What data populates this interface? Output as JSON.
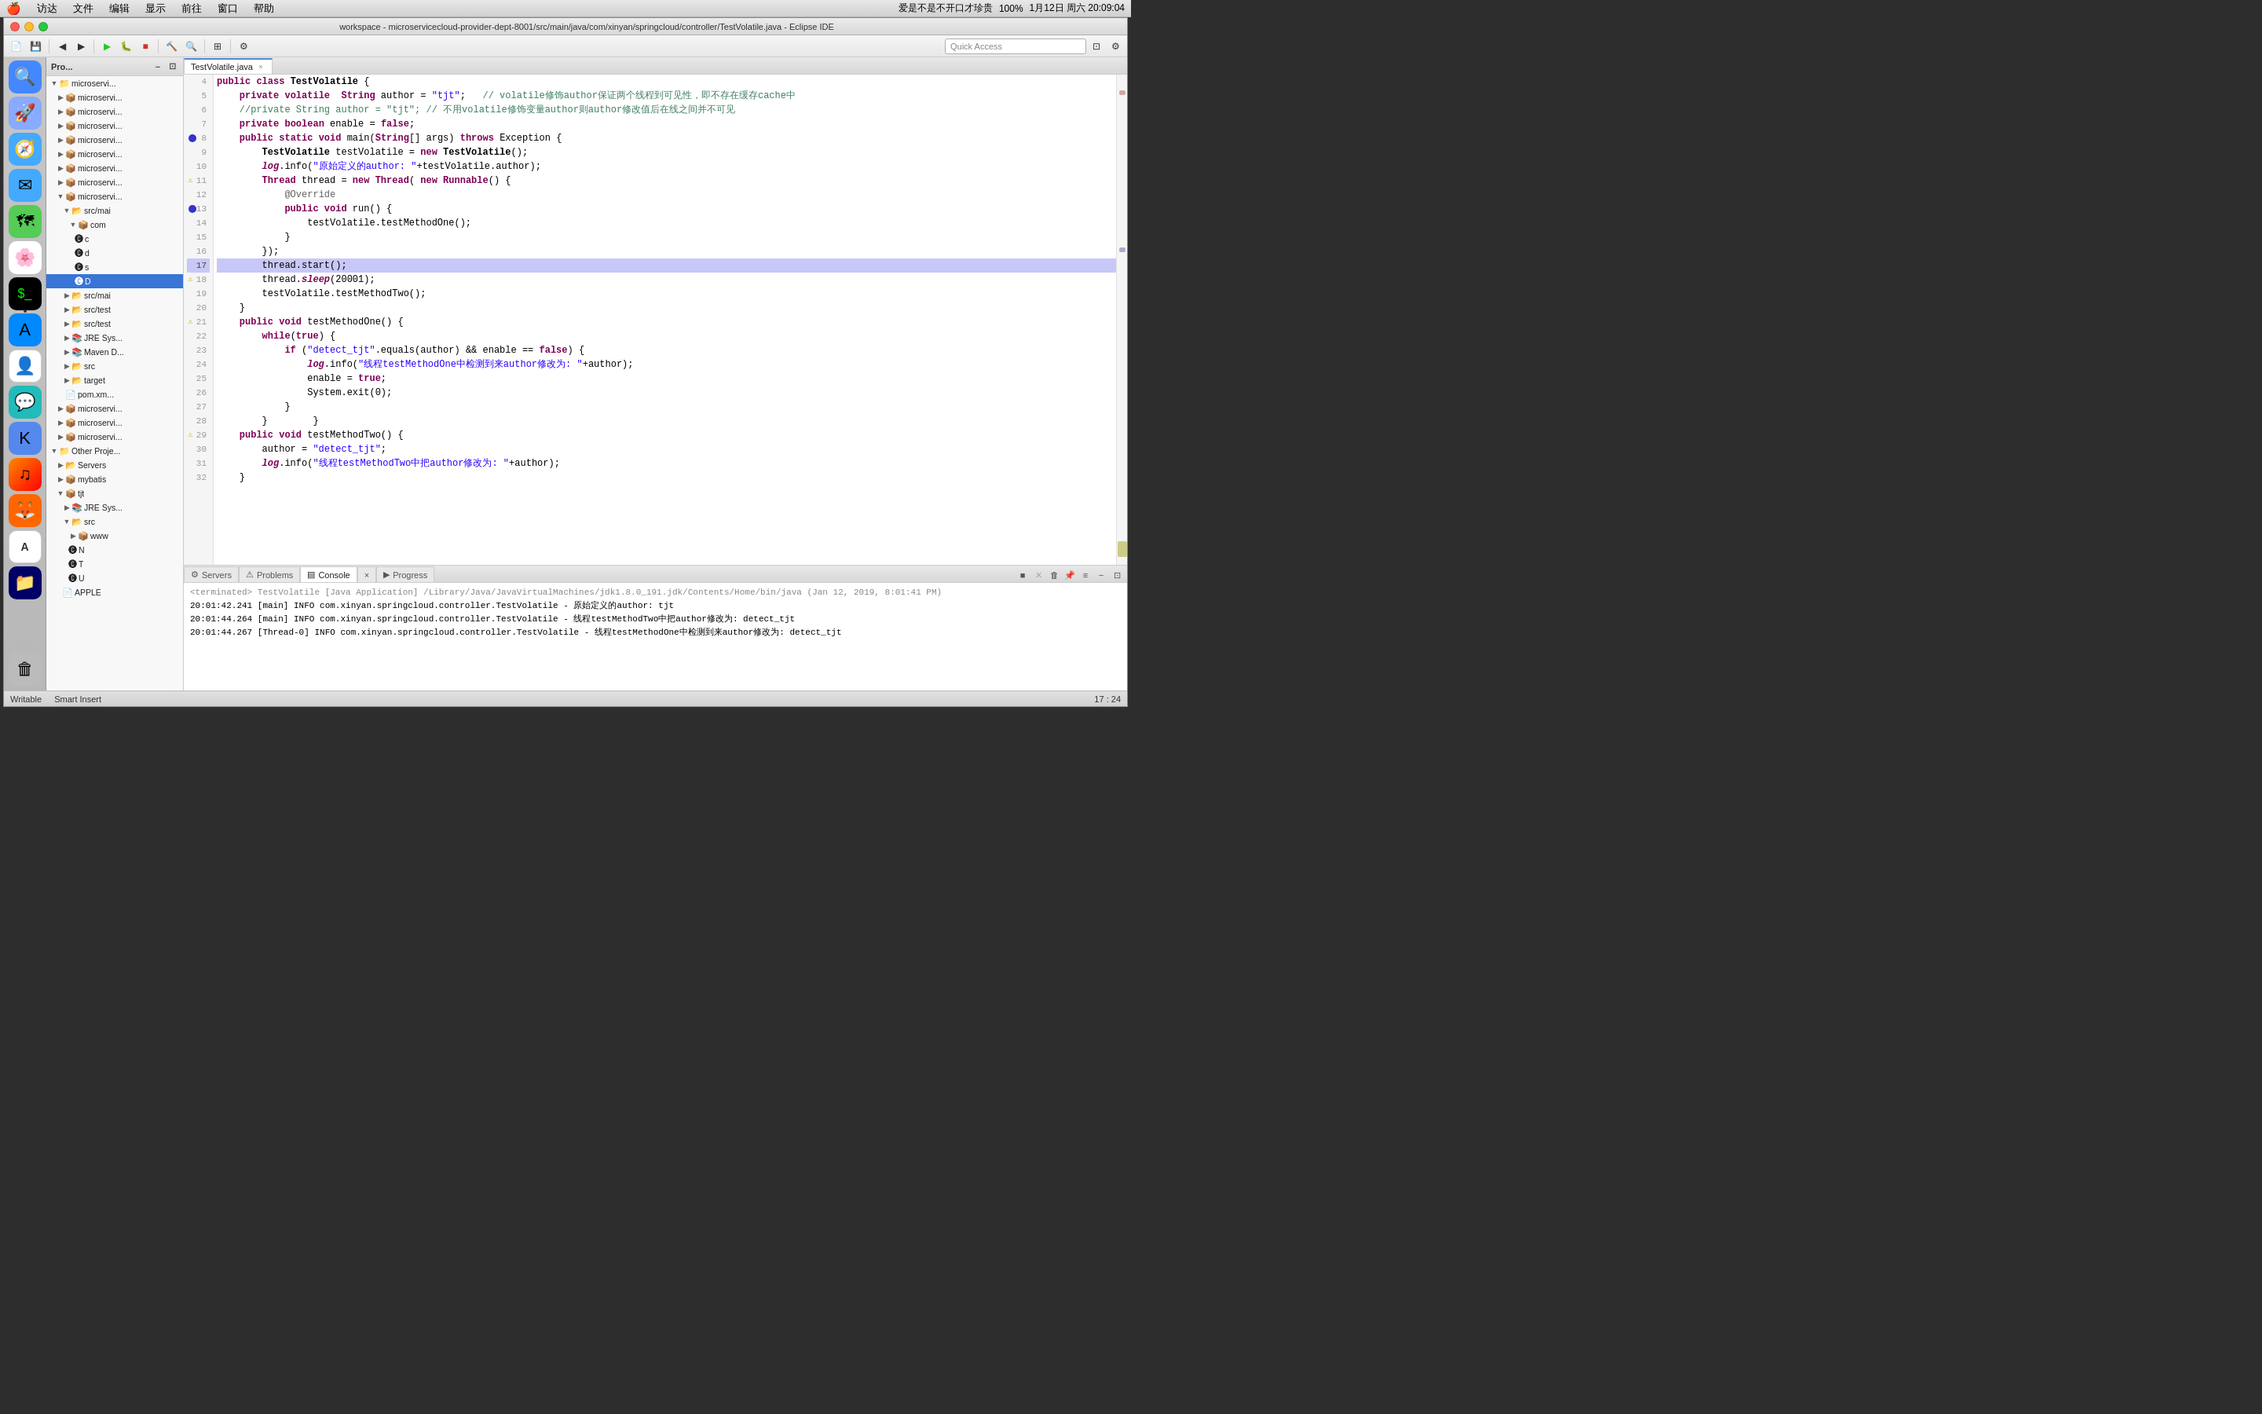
{
  "menubar": {
    "apple": "🍎",
    "items": [
      "访达",
      "文件",
      "编辑",
      "显示",
      "前往",
      "窗口",
      "帮助"
    ],
    "right": {
      "title": "爱是不是不开口才珍贵",
      "battery": "100%",
      "datetime": "1月12日 周六 20:09:04"
    }
  },
  "window": {
    "title": "workspace - microservicecloud-provider-dept-8001/src/main/java/com/xinyan/springcloud/controller/TestVolatile.java - Eclipse IDE"
  },
  "toolbar": {
    "quick_access_placeholder": "Quick Access"
  },
  "editor_tab": {
    "filename": "TestVolatile.java",
    "close_icon": "×"
  },
  "code": {
    "lines": [
      {
        "num": 4,
        "content": "public class TestVolatile {",
        "type": "normal"
      },
      {
        "num": 5,
        "content": "    private volatile  String author = \"tjt\";   // volatile修饰author保证两个线程到可见性，即不存在缓存cache中",
        "type": "normal"
      },
      {
        "num": 6,
        "content": "    //private String author = \"tjt\";   // 不用volatile修饰变量author则author修改值后在线之间并不可见",
        "type": "normal"
      },
      {
        "num": 7,
        "content": "    private boolean enable = false;",
        "type": "normal"
      },
      {
        "num": 8,
        "content": "    public static void main(String[] args) throws Exception {",
        "type": "breakpoint"
      },
      {
        "num": 9,
        "content": "        TestVolatile testVolatile = new TestVolatile();",
        "type": "normal"
      },
      {
        "num": 10,
        "content": "        log.info(\"原始定义的author: \"+testVolatile.author);",
        "type": "normal"
      },
      {
        "num": 11,
        "content": "        Thread thread = new Thread( new Runnable() {",
        "type": "warning"
      },
      {
        "num": 12,
        "content": "            @Override",
        "type": "normal"
      },
      {
        "num": 13,
        "content": "            public void run() {",
        "type": "breakpoint"
      },
      {
        "num": 14,
        "content": "                testVolatile.testMethodOne();",
        "type": "normal"
      },
      {
        "num": 15,
        "content": "            }",
        "type": "normal"
      },
      {
        "num": 16,
        "content": "        });",
        "type": "normal"
      },
      {
        "num": 17,
        "content": "        thread.start();",
        "type": "highlighted"
      },
      {
        "num": 18,
        "content": "        thread.sleep(20001);",
        "type": "breakpoint"
      },
      {
        "num": 19,
        "content": "        testVolatile.testMethodTwo();",
        "type": "normal"
      },
      {
        "num": 20,
        "content": "    }",
        "type": "normal"
      },
      {
        "num": 21,
        "content": "    public void testMethodOne() {",
        "type": "warning"
      },
      {
        "num": 22,
        "content": "        while(true) {",
        "type": "normal"
      },
      {
        "num": 23,
        "content": "            if (\"detect_tjt\".equals(author) && enable == false) {",
        "type": "normal"
      },
      {
        "num": 24,
        "content": "                log.info(\"线程testMethodOne中检测到来author修改为: \"+author);",
        "type": "normal"
      },
      {
        "num": 25,
        "content": "                enable = true;",
        "type": "normal"
      },
      {
        "num": 26,
        "content": "                System.exit(0);",
        "type": "normal"
      },
      {
        "num": 27,
        "content": "            }",
        "type": "normal"
      },
      {
        "num": 28,
        "content": "        }        }",
        "type": "normal"
      },
      {
        "num": 29,
        "content": "    public void testMethodTwo() {",
        "type": "warning"
      },
      {
        "num": 30,
        "content": "        author = \"detect_tjt\";",
        "type": "normal"
      },
      {
        "num": 31,
        "content": "        log.info(\"线程testMethodTwo中把author修改为: \"+author);",
        "type": "normal"
      },
      {
        "num": 32,
        "content": "    }",
        "type": "normal"
      }
    ]
  },
  "bottom_tabs": [
    {
      "id": "servers",
      "label": "Servers",
      "icon": "⚙"
    },
    {
      "id": "problems",
      "label": "Problems",
      "icon": "⚠"
    },
    {
      "id": "console",
      "label": "Console",
      "icon": "▤",
      "active": true
    },
    {
      "id": "console-close",
      "label": "×"
    },
    {
      "id": "progress",
      "label": "Progress",
      "icon": "▶"
    }
  ],
  "console": {
    "terminated_line": "<terminated> TestVolatile [Java Application] /Library/Java/JavaVirtualMachines/jdk1.8.0_191.jdk/Contents/Home/bin/java (Jan 12, 2019, 8:01:41 PM)",
    "lines": [
      "20:01:42.241 [main] INFO com.xinyan.springcloud.controller.TestVolatile - 原始定义的author: tjt",
      "20:01:44.264 [main] INFO com.xinyan.springcloud.controller.TestVolatile - 线程testMethodTwo中把author修改为: detect_tjt",
      "20:01:44.267 [Thread-0] INFO com.xinyan.springcloud.controller.TestVolatile - 线程testMethodOne中检测到来author修改为: detect_tjt"
    ]
  },
  "status_bar": {
    "writable": "Writable",
    "smart_insert": "Smart Insert",
    "position": "17 : 24"
  },
  "project_tree": {
    "items": [
      {
        "label": "Pro...",
        "level": 0,
        "type": "header",
        "arrow": "▼"
      },
      {
        "label": "microservi...",
        "level": 1,
        "type": "folder",
        "arrow": "▶"
      },
      {
        "label": "microservi...",
        "level": 1,
        "type": "folder",
        "arrow": "▶"
      },
      {
        "label": "microservi...",
        "level": 1,
        "type": "folder",
        "arrow": "▶"
      },
      {
        "label": "microservi...",
        "level": 1,
        "type": "folder",
        "arrow": "▶"
      },
      {
        "label": "microservi...",
        "level": 1,
        "type": "folder",
        "arrow": "▶"
      },
      {
        "label": "microservi...",
        "level": 1,
        "type": "folder",
        "arrow": "▶"
      },
      {
        "label": "microservi...",
        "level": 1,
        "type": "folder",
        "arrow": "▶"
      },
      {
        "label": "microservi...",
        "level": 1,
        "type": "folder",
        "arrow": "▼"
      },
      {
        "label": "src/mai",
        "level": 2,
        "type": "folder",
        "arrow": "▼"
      },
      {
        "label": "com",
        "level": 3,
        "type": "package",
        "arrow": "▼"
      },
      {
        "label": "c",
        "level": 4,
        "type": "class",
        "arrow": ""
      },
      {
        "label": "d",
        "level": 4,
        "type": "class",
        "arrow": ""
      },
      {
        "label": "s",
        "level": 4,
        "type": "class",
        "arrow": ""
      },
      {
        "label": "D",
        "level": 4,
        "type": "class",
        "arrow": ""
      },
      {
        "label": "src/mai",
        "level": 2,
        "type": "folder",
        "arrow": "▶"
      },
      {
        "label": "src/test",
        "level": 2,
        "type": "folder",
        "arrow": "▶"
      },
      {
        "label": "src/test",
        "level": 2,
        "type": "folder",
        "arrow": "▶"
      },
      {
        "label": "JRE Sys...",
        "level": 2,
        "type": "library",
        "arrow": "▶"
      },
      {
        "label": "Maven D...",
        "level": 2,
        "type": "library",
        "arrow": "▶"
      },
      {
        "label": "src",
        "level": 2,
        "type": "folder",
        "arrow": "▶"
      },
      {
        "label": "target",
        "level": 2,
        "type": "folder",
        "arrow": "▶"
      },
      {
        "label": "pom.xm...",
        "level": 2,
        "type": "file",
        "arrow": ""
      },
      {
        "label": "microservi...",
        "level": 1,
        "type": "folder",
        "arrow": "▶"
      },
      {
        "label": "microservi...",
        "level": 1,
        "type": "folder",
        "arrow": "▶"
      },
      {
        "label": "microservi...",
        "level": 1,
        "type": "folder",
        "arrow": "▶"
      },
      {
        "label": "Other Proje...",
        "level": 0,
        "type": "header",
        "arrow": "▼"
      },
      {
        "label": "Servers",
        "level": 1,
        "type": "folder",
        "arrow": "▶"
      },
      {
        "label": "mybatis",
        "level": 1,
        "type": "folder",
        "arrow": "▶"
      },
      {
        "label": "tjt",
        "level": 1,
        "type": "folder",
        "arrow": "▼"
      },
      {
        "label": "JRE Sys...",
        "level": 2,
        "type": "library",
        "arrow": "▶"
      },
      {
        "label": "src",
        "level": 2,
        "type": "folder",
        "arrow": "▼"
      },
      {
        "label": "www",
        "level": 3,
        "type": "folder",
        "arrow": "▶"
      },
      {
        "label": "N",
        "level": 3,
        "type": "class",
        "arrow": ""
      },
      {
        "label": "T",
        "level": 3,
        "type": "class",
        "arrow": ""
      },
      {
        "label": "U",
        "level": 3,
        "type": "class",
        "arrow": ""
      },
      {
        "label": "APPLE",
        "level": 2,
        "type": "file",
        "arrow": ""
      }
    ]
  }
}
